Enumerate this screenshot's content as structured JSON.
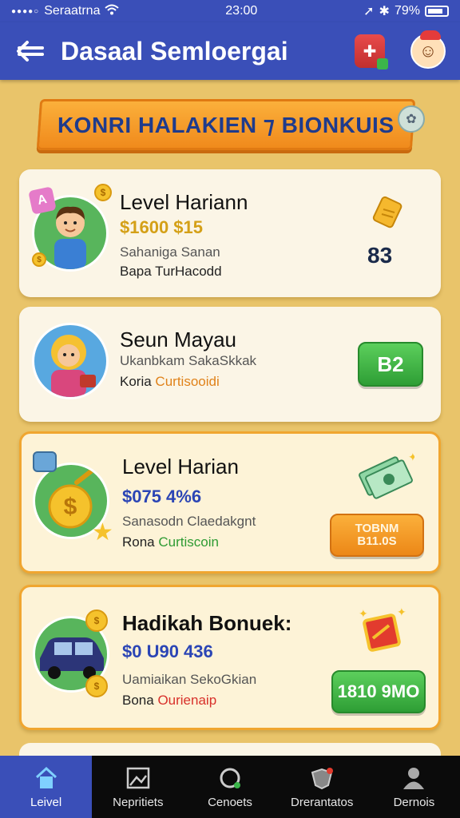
{
  "status_bar": {
    "carrier": "Seraatrna",
    "time": "23:00",
    "battery": "79%"
  },
  "app_bar": {
    "title": "Dasaal Semloergai"
  },
  "banner": {
    "text": "KONRI HALAKIEN ⁊ BIONKUIS"
  },
  "cards": [
    {
      "title": "Level Hariann",
      "amount": "$1600 $15",
      "subtitle": "Sahaniga Sanan",
      "bonus_prefix": "Bapa ",
      "bonus_accent": "TurHacodd",
      "badge": "83",
      "amount_color": "#d4a017"
    },
    {
      "title": "Seun Mayau",
      "subtitle": "Ukanbkam SakaSkkak",
      "bonus_prefix": "Koria ",
      "bonus_accent": "Curtisooidi",
      "button": "B2"
    },
    {
      "title": "Level Harian",
      "amount": "$075 4%6",
      "subtitle": "Sanasodn Claedakgnt",
      "bonus_prefix": "Rona ",
      "bonus_accent": "Curtiscoin",
      "button_line1": "TOBNM",
      "button_line2": "B11.0S",
      "amount_color": "#2b45b5"
    },
    {
      "title": "Hadikah Bonuek:",
      "amount": "$0 U90 436",
      "subtitle": "Uamiaikan SekoGkian",
      "bonus_prefix": "Bona ",
      "bonus_accent": "Ourienaip",
      "button": "1810 9MO",
      "amount_color": "#2b45b5"
    }
  ],
  "bottom_nav": [
    {
      "label": "Leivel",
      "icon": "home-icon",
      "active": true
    },
    {
      "label": "Nepritiets",
      "icon": "image-icon",
      "active": false
    },
    {
      "label": "Cenoets",
      "icon": "refresh-icon",
      "active": false
    },
    {
      "label": "Drerantatos",
      "icon": "shield-icon",
      "active": false
    },
    {
      "label": "Dernois",
      "icon": "person-icon",
      "active": false
    }
  ],
  "colors": {
    "primary": "#3a4fb8",
    "background": "#e9c46a",
    "accent_orange": "#f08a1c",
    "accent_green": "#2e9b33"
  }
}
